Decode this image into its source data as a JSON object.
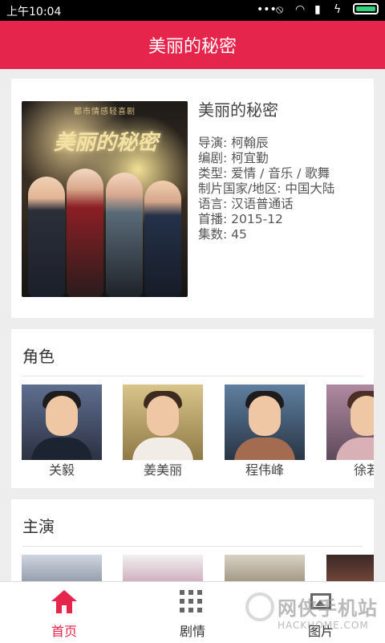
{
  "status_bar": {
    "time": "上午10:04",
    "icons": [
      "more-dots-icon",
      "mute-icon",
      "wifi-icon",
      "signal-icon",
      "charging-icon",
      "battery-icon"
    ]
  },
  "app_bar": {
    "title": "美丽的秘密"
  },
  "info": {
    "title": "美丽的秘密",
    "poster": {
      "banner_text": "都市情感轻喜剧",
      "logo_text": "美丽的秘密"
    },
    "lines": [
      "导演: 柯翰辰",
      "编剧: 柯宜勤",
      "类型: 爱情 / 音乐 / 歌舞",
      "制片国家/地区: 中国大陆",
      "语言: 汉语普通话",
      "首播: 2015-12",
      "集数: 45"
    ]
  },
  "roles": {
    "title": "角色",
    "items": [
      {
        "name": "关毅"
      },
      {
        "name": "姜美丽"
      },
      {
        "name": "程伟峰"
      },
      {
        "name": "徐若"
      }
    ]
  },
  "cast": {
    "title": "主演",
    "items": [
      {
        "name": ""
      },
      {
        "name": ""
      },
      {
        "name": ""
      },
      {
        "name": ""
      }
    ]
  },
  "bottom_nav": {
    "items": [
      {
        "label": "首页",
        "icon": "home-icon",
        "active": true
      },
      {
        "label": "剧情",
        "icon": "grid-icon",
        "active": false
      },
      {
        "label": "图片",
        "icon": "image-icon",
        "active": false
      }
    ]
  },
  "watermark": {
    "main": "网侠手机站",
    "sub": "HACKHOME.COM"
  },
  "colors": {
    "accent": "#e6254d",
    "background": "#ededed",
    "card": "#ffffff"
  }
}
